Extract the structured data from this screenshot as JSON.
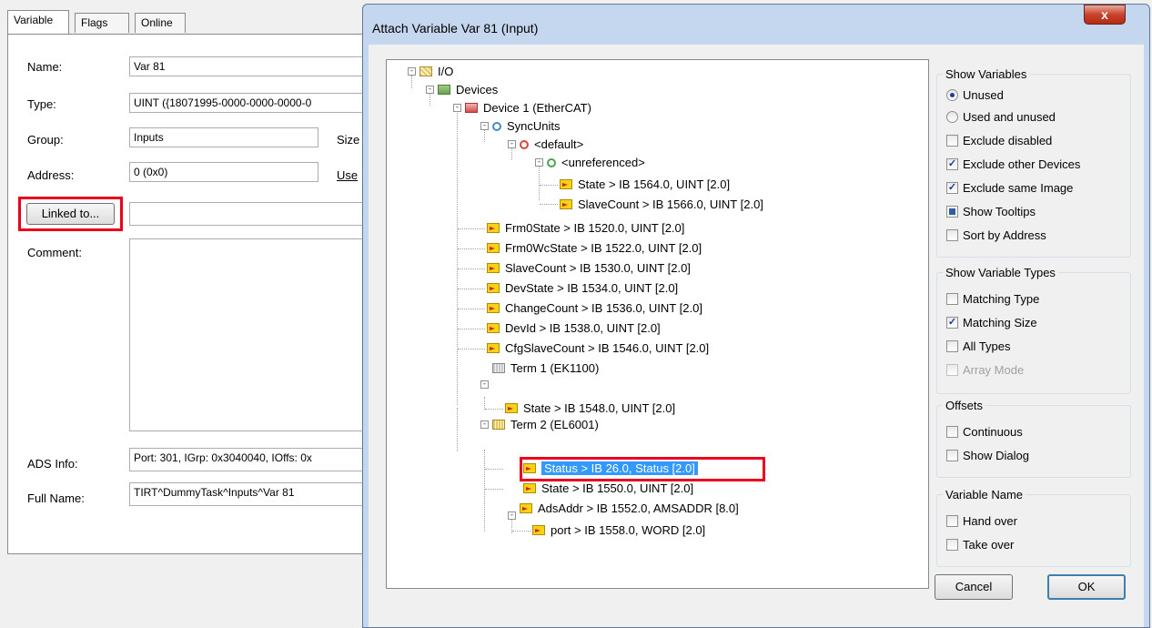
{
  "background_panel": {
    "tabs": [
      "Variable",
      "Flags",
      "Online"
    ],
    "labels": {
      "name": "Name:",
      "type": "Type:",
      "group": "Group:",
      "address": "Address:",
      "comment": "Comment:",
      "ads_info": "ADS Info:",
      "full_name": "Full Name:",
      "size": "Size",
      "user": "Use"
    },
    "values": {
      "name": "Var 81",
      "type": "UINT ({18071995-0000-0000-0000-0",
      "group": "Inputs",
      "address": "0 (0x0)",
      "linked": "",
      "ads_info": "Port: 301, IGrp: 0x3040040, IOffs: 0x",
      "full_name": "TIRT^DummyTask^Inputs^Var 81"
    },
    "linked_button": "Linked to..."
  },
  "dialog": {
    "title": "Attach Variable Var 81 (Input)",
    "close_label": "x",
    "tree": [
      {
        "label": "I/O"
      },
      {
        "label": "Devices"
      },
      {
        "label": "Device 1 (EtherCAT)"
      },
      {
        "label": "SyncUnits"
      },
      {
        "label": "<default>"
      },
      {
        "label": "<unreferenced>"
      },
      {
        "label": "State  >  IB 1564.0, UINT [2.0]"
      },
      {
        "label": "SlaveCount  >  IB 1566.0, UINT [2.0]"
      },
      {
        "label": "Frm0State  >  IB 1520.0, UINT [2.0]"
      },
      {
        "label": "Frm0WcState  >  IB 1522.0, UINT [2.0]"
      },
      {
        "label": "SlaveCount  >  IB 1530.0, UINT [2.0]"
      },
      {
        "label": "DevState  >  IB 1534.0, UINT [2.0]"
      },
      {
        "label": "ChangeCount  >  IB 1536.0, UINT [2.0]"
      },
      {
        "label": "DevId  >  IB 1538.0, UINT [2.0]"
      },
      {
        "label": "CfgSlaveCount  >  IB 1546.0, UINT [2.0]"
      },
      {
        "label": "Term 1 (EK1100)"
      },
      {
        "label": "State  >  IB 1548.0, UINT [2.0]"
      },
      {
        "label": "Term 2 (EL6001)"
      },
      {
        "label": "Status  >  IB 26.0, Status [2.0]"
      },
      {
        "label": "State  >  IB 1550.0, UINT [2.0]"
      },
      {
        "label": "AdsAddr  >  IB 1552.0, AMSADDR [8.0]"
      },
      {
        "label": "port  >  IB 1558.0, WORD [2.0]"
      }
    ],
    "show_variables": {
      "title": "Show Variables",
      "unused": "Unused",
      "used_and_unused": "Used and unused",
      "exclude_disabled": "Exclude disabled",
      "exclude_other_devices": "Exclude other Devices",
      "exclude_same_image": "Exclude same Image",
      "show_tooltips": "Show Tooltips",
      "sort_by_address": "Sort by Address"
    },
    "show_variable_types": {
      "title": "Show Variable Types",
      "matching_type": "Matching Type",
      "matching_size": "Matching Size",
      "all_types": "All Types",
      "array_mode": "Array Mode"
    },
    "offsets": {
      "title": "Offsets",
      "continuous": "Continuous",
      "show_dialog": "Show Dialog"
    },
    "variable_name": {
      "title": "Variable Name",
      "hand_over": "Hand over",
      "take_over": "Take over"
    },
    "buttons": {
      "cancel": "Cancel",
      "ok": "OK"
    },
    "checkmark": "✓",
    "state": {
      "unused_selected": true,
      "exclude_other_devices": true,
      "exclude_same_image": true,
      "show_tooltips": "indeterminate",
      "matching_size": true
    }
  },
  "colors": {
    "highlight_red": "#e8001c",
    "selection_blue": "#3399ff"
  }
}
